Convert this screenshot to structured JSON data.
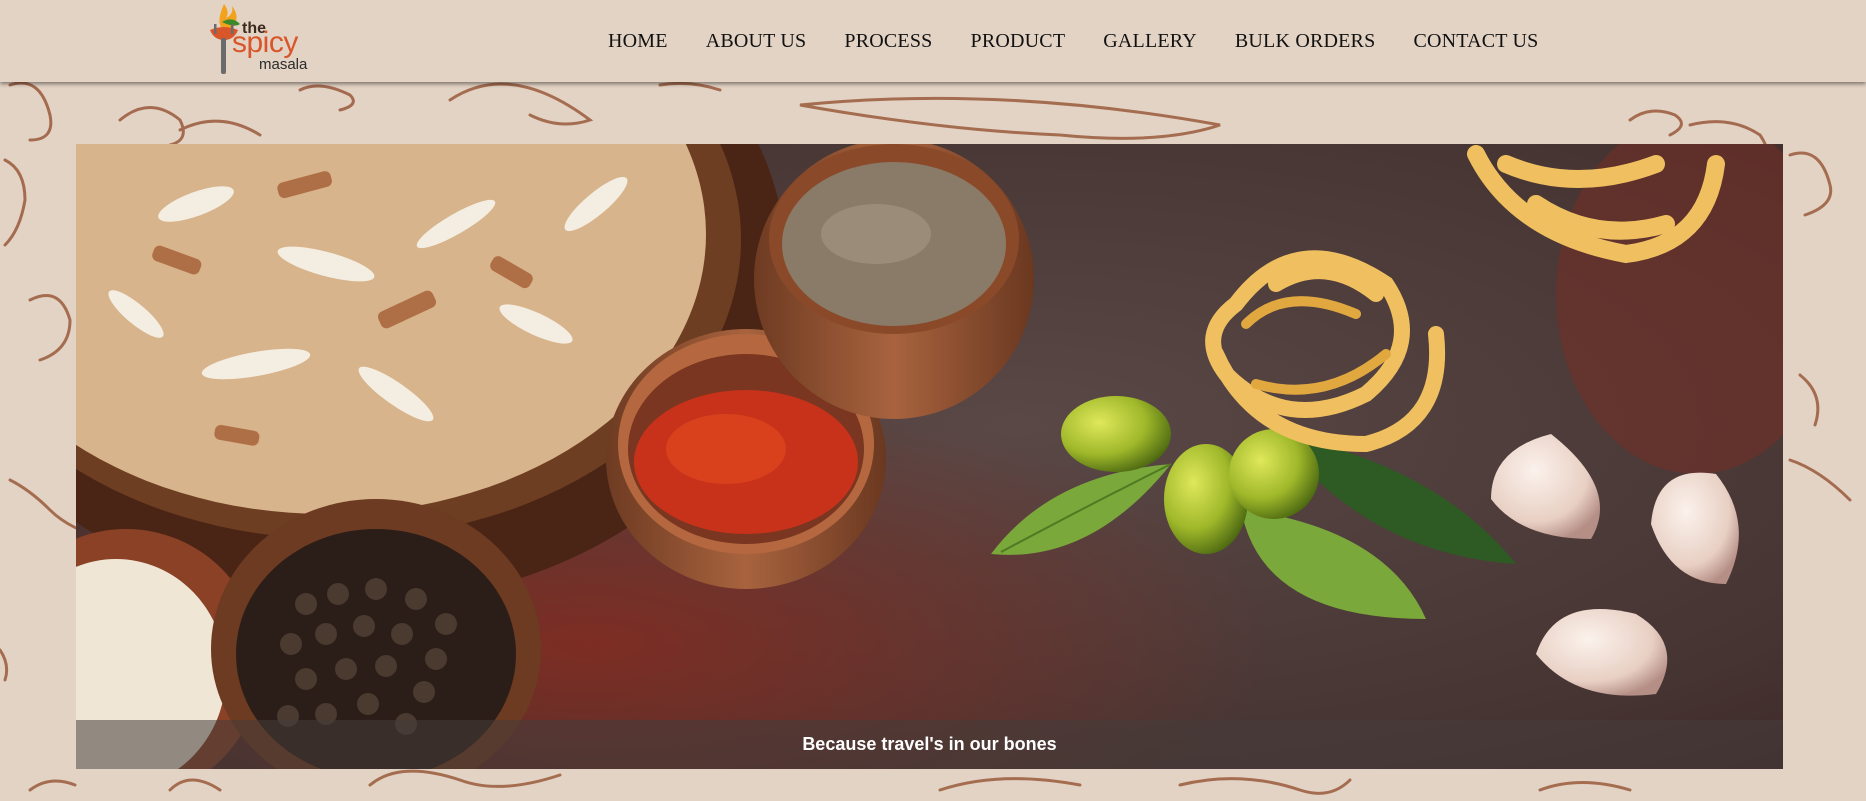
{
  "brand": {
    "logo_the": "the",
    "logo_spicy": "spicy",
    "logo_masala": "masala",
    "logo_color": "#d8562a"
  },
  "nav": {
    "items": [
      {
        "label": "HOME"
      },
      {
        "label": "ABOUT US"
      },
      {
        "label": "PROCESS"
      },
      {
        "label": "PRODUCT"
      },
      {
        "label": "GALLERY"
      },
      {
        "label": "BULK ORDERS"
      },
      {
        "label": "CONTACT US"
      }
    ]
  },
  "hero": {
    "caption": "Because travel's in our bones",
    "image_subject": "spices, rice, peppercorns, chili powder, pasta nests, limes and garlic on a dark table"
  },
  "colors": {
    "page_background": "#e3d3c4",
    "doodle_color": "#9a5a3c",
    "caption_text": "#ffffff"
  }
}
